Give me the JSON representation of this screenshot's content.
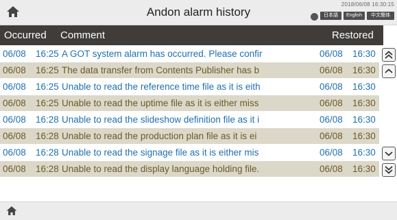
{
  "window": {
    "title": "Andon alarm history",
    "datetime": "2018/06/08 16:30:15"
  },
  "languages": [
    "日本語",
    "English",
    "中文簡体"
  ],
  "table": {
    "headers": {
      "occurred": "Occurred",
      "comment": "Comment",
      "restored": "Restored"
    },
    "rows": [
      {
        "date": "06/08",
        "time": "16:25",
        "comment": "A GOT system alarm has occurred. Please confir",
        "rdate": "06/08",
        "rtime": "16:30"
      },
      {
        "date": "06/08",
        "time": "16:25",
        "comment": "The data transfer from Contents Publisher has b",
        "rdate": "06/08",
        "rtime": "16:30"
      },
      {
        "date": "06/08",
        "time": "16:25",
        "comment": "Unable to read the reference time file as it is eith",
        "rdate": "06/08",
        "rtime": "16:30"
      },
      {
        "date": "06/08",
        "time": "16:25",
        "comment": "Unable to read the uptime file as it is either miss",
        "rdate": "06/08",
        "rtime": "16:30"
      },
      {
        "date": "06/08",
        "time": "16:28",
        "comment": "Unable to read the slideshow definition file as it i",
        "rdate": "06/08",
        "rtime": "16:30"
      },
      {
        "date": "06/08",
        "time": "16:28",
        "comment": "Unable to read the production plan file as it is ei",
        "rdate": "06/08",
        "rtime": "16:30"
      },
      {
        "date": "06/08",
        "time": "16:28",
        "comment": "Unable to read the signage file as it is either mis",
        "rdate": "06/08",
        "rtime": "16:30"
      },
      {
        "date": "06/08",
        "time": "16:28",
        "comment": "Unable to read the display language holding file.",
        "rdate": "06/08",
        "rtime": "16:30"
      }
    ]
  },
  "icons": {
    "home": "home-icon",
    "globe": "globe-icon",
    "scroll_top": "double-chevron-up-icon",
    "scroll_up": "chevron-up-icon",
    "scroll_down": "chevron-down-icon",
    "scroll_bottom": "double-chevron-down-icon"
  },
  "colors": {
    "header_bg": "#3f3c3a",
    "row_alt_bg": "#dcd8c9",
    "row_alt_text": "#6a5a28",
    "row_text": "#1e6fb0"
  }
}
